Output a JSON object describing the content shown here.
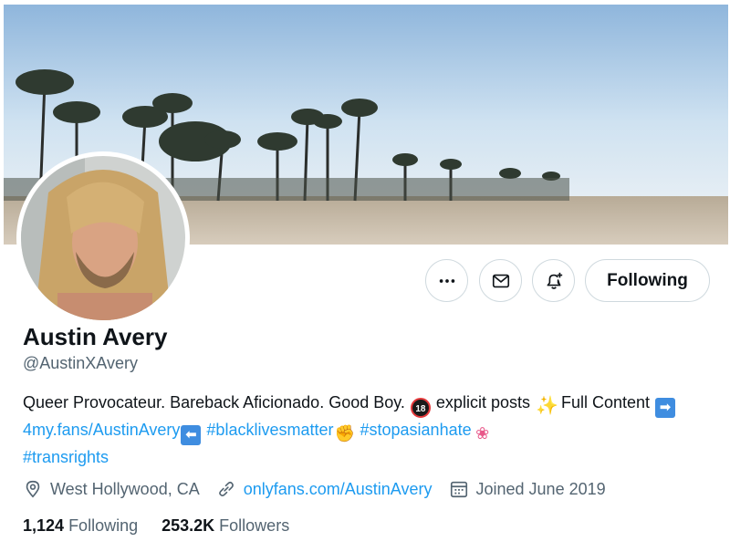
{
  "profile": {
    "display_name": "Austin Avery",
    "handle": "@AustinXAvery",
    "bio": {
      "part1": "Queer Provocateur. Bareback Aficionado. Good Boy. ",
      "part2": " explicit posts ",
      "part3": "  Full Content ",
      "link1": "4my.fans/AustinAvery",
      "tag1": "#blacklivesmatter",
      "tag2": "#stopasianhate",
      "tag3": "#transrights"
    },
    "location": "West Hollywood, CA",
    "website": "onlyfans.com/AustinAvery",
    "joined": "Joined June 2019",
    "following_count": "1,124",
    "following_label": "Following",
    "followers_count": "253.2K",
    "followers_label": "Followers"
  },
  "actions": {
    "follow_button": "Following",
    "more_icon": "more-icon",
    "mail_icon": "mail-icon",
    "notify_icon": "bell-plus-icon"
  },
  "emojis": {
    "adult": "18",
    "arrow_right": "➡",
    "arrow_left": "⬅",
    "sparkles": "✨",
    "fists": "✊",
    "lotus": "❀"
  },
  "colors": {
    "link": "#1d9bf0",
    "text": "#0f1419",
    "secondary": "#536471",
    "border": "#cfd9de"
  }
}
